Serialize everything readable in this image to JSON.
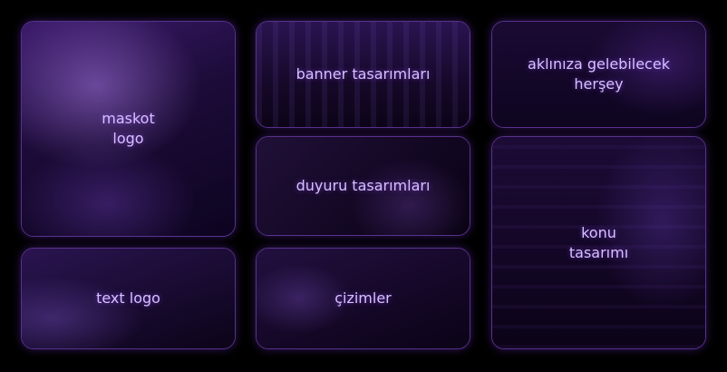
{
  "tiles": {
    "maskot": {
      "label": "maskot\nlogo"
    },
    "banner": {
      "label": "banner tasarımları"
    },
    "aklin": {
      "label": "aklınıza gelebilecek\nherşey"
    },
    "duyuru": {
      "label": "duyuru tasarımları"
    },
    "konu": {
      "label": "konu\ntasarımı"
    },
    "text": {
      "label": "text logo"
    },
    "cizim": {
      "label": "çizimler"
    }
  },
  "colors": {
    "page_bg": "#000000",
    "tile_border": "#a05aff",
    "label_text": "#d7c0ff"
  }
}
